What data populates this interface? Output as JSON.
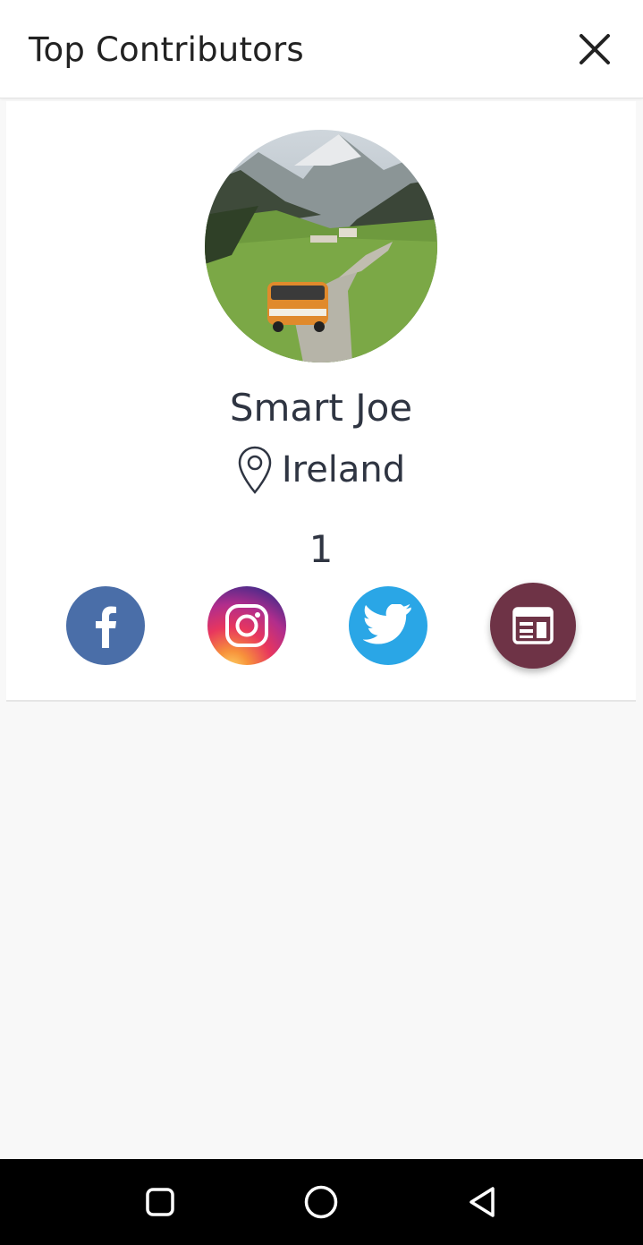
{
  "header": {
    "title": "Top Contributors",
    "close_icon": "close-icon"
  },
  "profile": {
    "avatar_icon": "landscape-photo-avatar",
    "name": "Smart Joe",
    "location": "Ireland",
    "location_icon": "location-pin-icon",
    "count": "1"
  },
  "social": [
    {
      "name": "facebook",
      "icon": "facebook-icon",
      "color": "#4a6ea8"
    },
    {
      "name": "instagram",
      "icon": "instagram-icon",
      "color": "#c13584"
    },
    {
      "name": "twitter",
      "icon": "twitter-icon",
      "color": "#2aa6e6"
    },
    {
      "name": "news",
      "icon": "newspaper-icon",
      "color": "#6e3346"
    }
  ],
  "system_nav": {
    "recents_icon": "square-icon",
    "home_icon": "circle-icon",
    "back_icon": "triangle-back-icon"
  }
}
